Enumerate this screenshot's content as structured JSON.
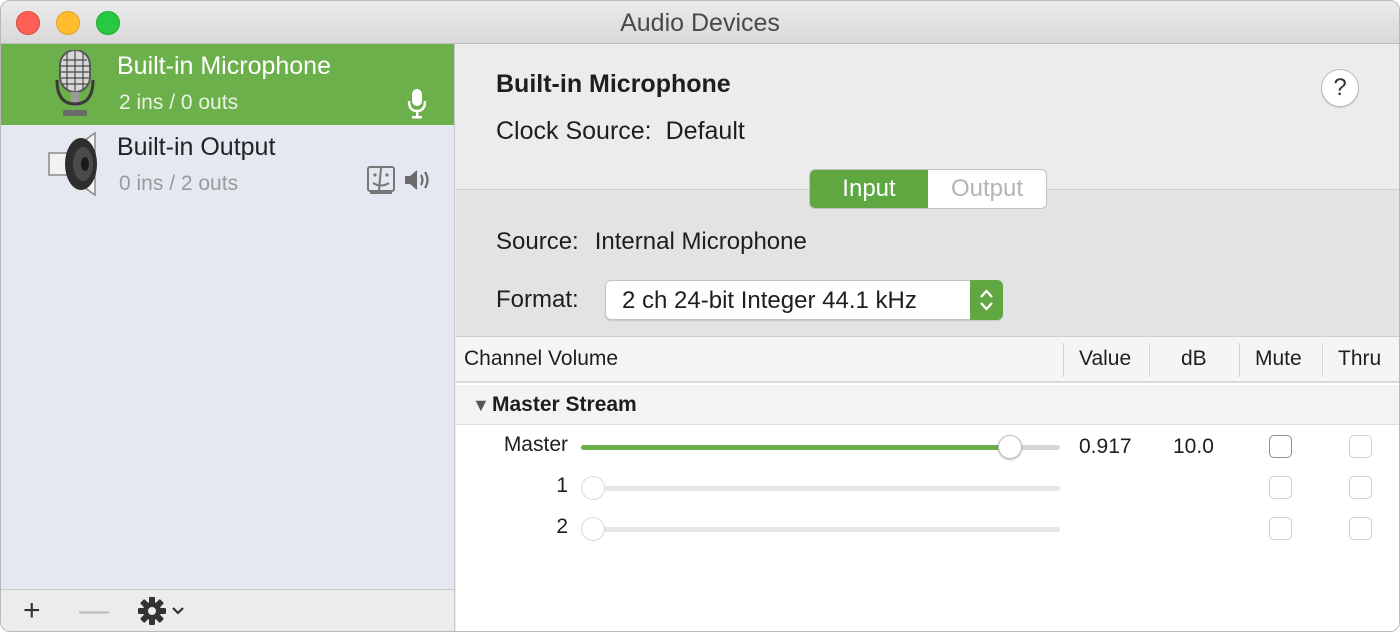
{
  "window": {
    "title": "Audio Devices"
  },
  "sidebar": {
    "devices": [
      {
        "name": "Built-in Microphone",
        "io": "2 ins / 0 outs",
        "icon": "microphone-icon",
        "selected": true
      },
      {
        "name": "Built-in Output",
        "io": "0 ins / 2 outs",
        "icon": "speaker-icon",
        "selected": false
      }
    ],
    "toolbar": {
      "add": "+",
      "remove": "—"
    }
  },
  "detail": {
    "device_title": "Built-in Microphone",
    "clock_label": "Clock Source:",
    "clock_value": "Default",
    "help": "?",
    "tabs": [
      {
        "label": "Input",
        "selected": true
      },
      {
        "label": "Output",
        "selected": false
      }
    ],
    "source_label": "Source:",
    "source_value": "Internal Microphone",
    "format_label": "Format:",
    "format_value": "2 ch 24-bit Integer 44.1 kHz"
  },
  "table": {
    "headers": {
      "channel": "Channel Volume",
      "value": "Value",
      "db": "dB",
      "mute": "Mute",
      "thru": "Thru"
    },
    "group": "Master Stream",
    "rows": [
      {
        "label": "Master",
        "level": 0.917,
        "value": "0.917",
        "db": "10.0",
        "mute": false,
        "thru": false
      },
      {
        "label": "1",
        "level": 0,
        "value": "",
        "db": "",
        "mute": false,
        "thru": false
      },
      {
        "label": "2",
        "level": 0,
        "value": "",
        "db": "",
        "mute": false,
        "thru": false
      }
    ]
  },
  "colors": {
    "accent_green": "#6cb04c",
    "segment_green": "#5fa740",
    "sidebar_bg": "#e3e8f1"
  }
}
